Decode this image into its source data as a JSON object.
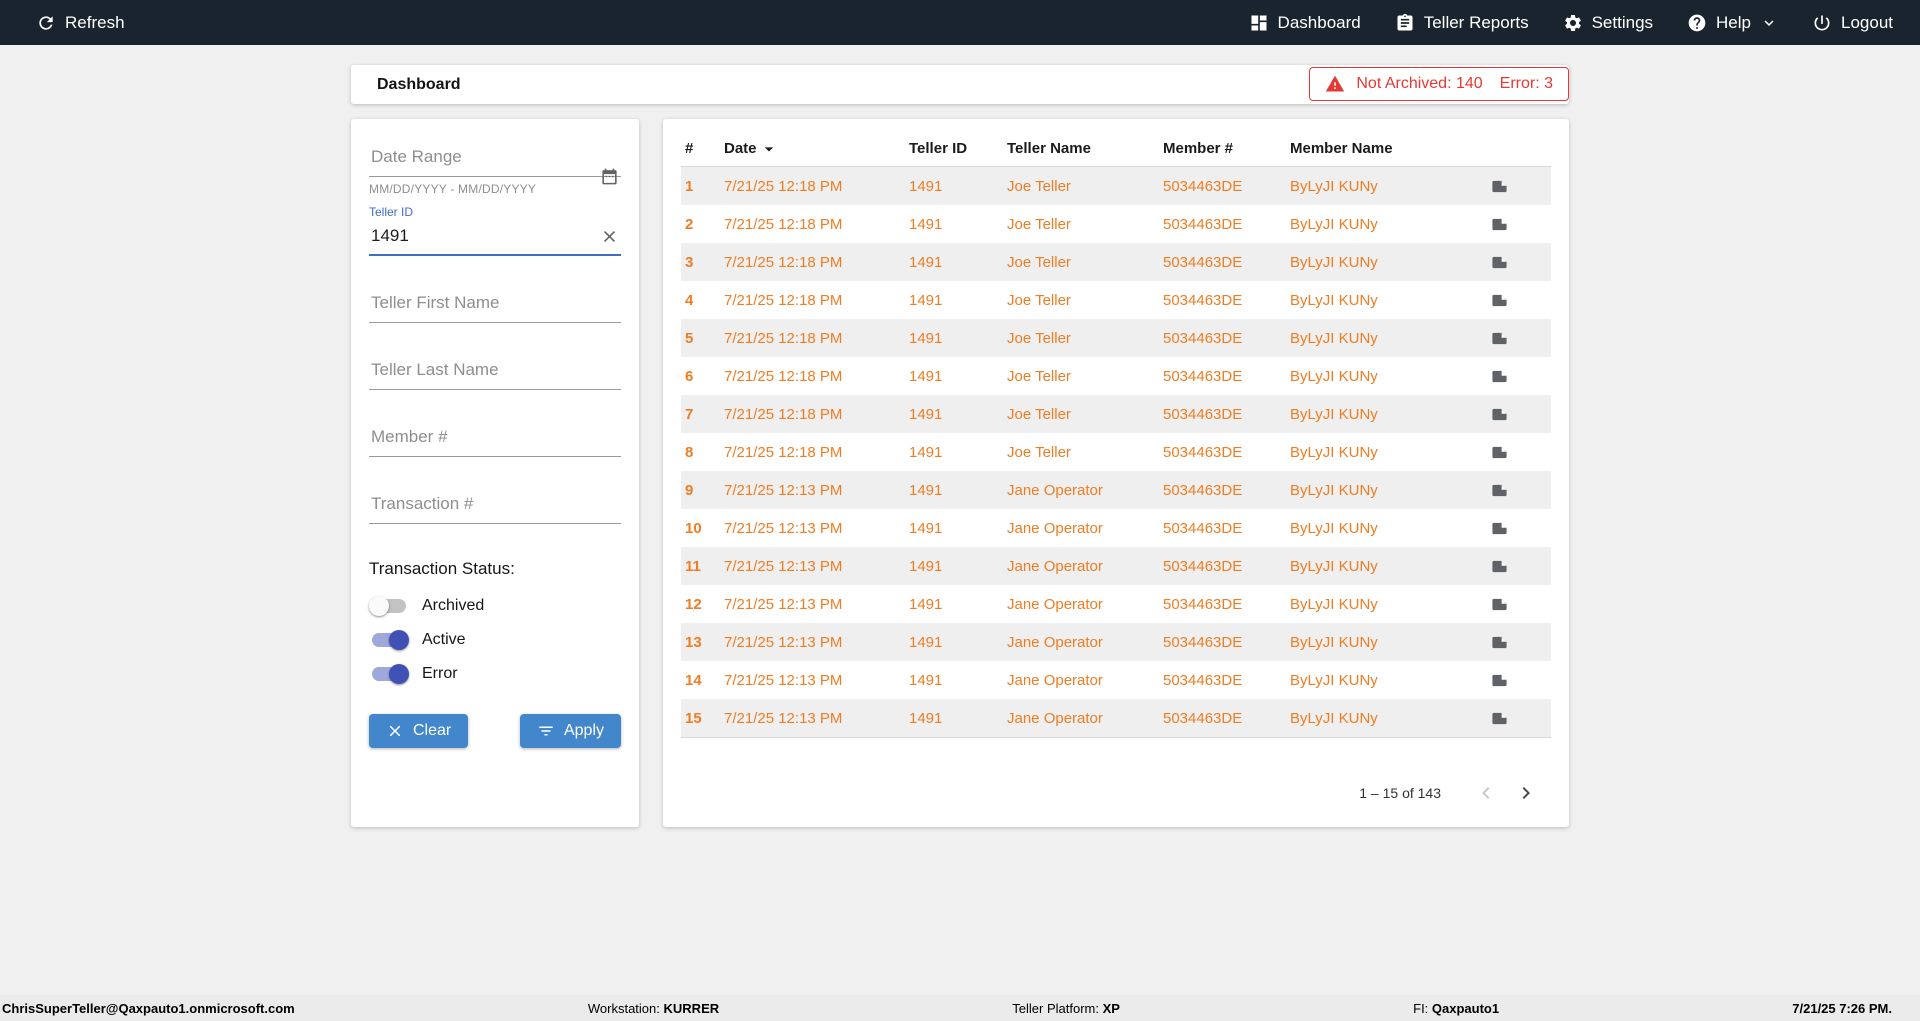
{
  "colors": {
    "topbar": "#1a242f",
    "accent": "#3f6dc6",
    "button_blue": "#4286cb",
    "indigo": "#3f51b5",
    "indigo_track": "#9fa8da",
    "orange": "#ee7d23",
    "red": "#e53935",
    "row_alt": "#efefef"
  },
  "topbar": {
    "refresh_label": "Refresh",
    "nav": [
      {
        "label": "Dashboard",
        "icon": "dashboard-icon"
      },
      {
        "label": "Teller Reports",
        "icon": "teller-reports-icon"
      },
      {
        "label": "Settings",
        "icon": "settings-icon"
      },
      {
        "label": "Help",
        "icon": "help-icon"
      },
      {
        "label": "Logout",
        "icon": "logout-icon"
      }
    ]
  },
  "header": {
    "title": "Dashboard",
    "alert": {
      "not_archived": "Not Archived: 140",
      "error": "Error: 3"
    }
  },
  "filters": {
    "date_range": {
      "placeholder": "Date Range",
      "hint": "MM/DD/YYYY - MM/DD/YYYY"
    },
    "teller_id": {
      "label": "Teller ID",
      "value": "1491"
    },
    "teller_first_name": {
      "placeholder": "Teller First Name"
    },
    "teller_last_name": {
      "placeholder": "Teller Last Name"
    },
    "member_number": {
      "placeholder": "Member #"
    },
    "transaction_number": {
      "placeholder": "Transaction #"
    },
    "status_label": "Transaction Status:",
    "toggles": [
      {
        "label": "Archived",
        "on": false
      },
      {
        "label": "Active",
        "on": true
      },
      {
        "label": "Error",
        "on": true
      }
    ],
    "clear_label": "Clear",
    "apply_label": "Apply"
  },
  "table": {
    "columns": [
      "#",
      "Date",
      "Teller ID",
      "Teller Name",
      "Member #",
      "Member Name"
    ],
    "rows": [
      {
        "num": "1",
        "date": "7/21/25 12:18 PM",
        "teller_id": "1491",
        "teller_name": "Joe Teller",
        "member_num": "5034463DE",
        "member_name": "ByLyJI KUNy"
      },
      {
        "num": "2",
        "date": "7/21/25 12:18 PM",
        "teller_id": "1491",
        "teller_name": "Joe Teller",
        "member_num": "5034463DE",
        "member_name": "ByLyJI KUNy"
      },
      {
        "num": "3",
        "date": "7/21/25 12:18 PM",
        "teller_id": "1491",
        "teller_name": "Joe Teller",
        "member_num": "5034463DE",
        "member_name": "ByLyJI KUNy"
      },
      {
        "num": "4",
        "date": "7/21/25 12:18 PM",
        "teller_id": "1491",
        "teller_name": "Joe Teller",
        "member_num": "5034463DE",
        "member_name": "ByLyJI KUNy"
      },
      {
        "num": "5",
        "date": "7/21/25 12:18 PM",
        "teller_id": "1491",
        "teller_name": "Joe Teller",
        "member_num": "5034463DE",
        "member_name": "ByLyJI KUNy"
      },
      {
        "num": "6",
        "date": "7/21/25 12:18 PM",
        "teller_id": "1491",
        "teller_name": "Joe Teller",
        "member_num": "5034463DE",
        "member_name": "ByLyJI KUNy"
      },
      {
        "num": "7",
        "date": "7/21/25 12:18 PM",
        "teller_id": "1491",
        "teller_name": "Joe Teller",
        "member_num": "5034463DE",
        "member_name": "ByLyJI KUNy"
      },
      {
        "num": "8",
        "date": "7/21/25 12:18 PM",
        "teller_id": "1491",
        "teller_name": "Joe Teller",
        "member_num": "5034463DE",
        "member_name": "ByLyJI KUNy"
      },
      {
        "num": "9",
        "date": "7/21/25 12:13 PM",
        "teller_id": "1491",
        "teller_name": "Jane Operator",
        "member_num": "5034463DE",
        "member_name": "ByLyJI KUNy"
      },
      {
        "num": "10",
        "date": "7/21/25 12:13 PM",
        "teller_id": "1491",
        "teller_name": "Jane Operator",
        "member_num": "5034463DE",
        "member_name": "ByLyJI KUNy"
      },
      {
        "num": "11",
        "date": "7/21/25 12:13 PM",
        "teller_id": "1491",
        "teller_name": "Jane Operator",
        "member_num": "5034463DE",
        "member_name": "ByLyJI KUNy"
      },
      {
        "num": "12",
        "date": "7/21/25 12:13 PM",
        "teller_id": "1491",
        "teller_name": "Jane Operator",
        "member_num": "5034463DE",
        "member_name": "ByLyJI KUNy"
      },
      {
        "num": "13",
        "date": "7/21/25 12:13 PM",
        "teller_id": "1491",
        "teller_name": "Jane Operator",
        "member_num": "5034463DE",
        "member_name": "ByLyJI KUNy"
      },
      {
        "num": "14",
        "date": "7/21/25 12:13 PM",
        "teller_id": "1491",
        "teller_name": "Jane Operator",
        "member_num": "5034463DE",
        "member_name": "ByLyJI KUNy"
      },
      {
        "num": "15",
        "date": "7/21/25 12:13 PM",
        "teller_id": "1491",
        "teller_name": "Jane Operator",
        "member_num": "5034463DE",
        "member_name": "ByLyJI KUNy"
      }
    ],
    "pagination": {
      "range_label": "1 – 15 of 143"
    }
  },
  "footer": {
    "user": "ChrisSuperTeller@Qaxpauto1.onmicrosoft.com",
    "workstation_label": "Workstation:",
    "workstation_value": "KURRER",
    "platform_label": "Teller Platform:",
    "platform_value": "XP",
    "fi_label": "FI:",
    "fi_value": "Qaxpauto1",
    "datetime": "7/21/25 7:26 PM."
  }
}
